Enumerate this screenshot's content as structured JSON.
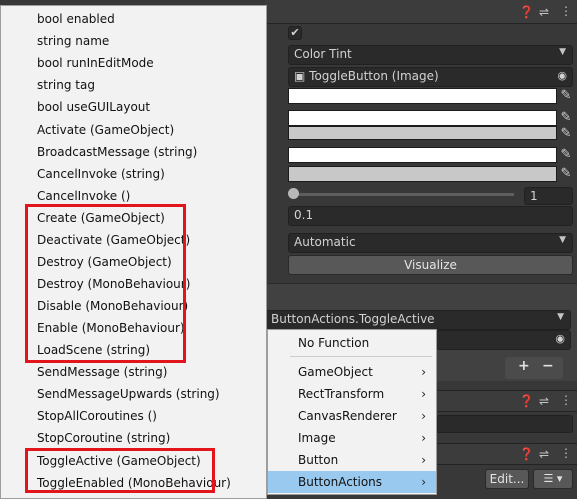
{
  "inspector": {
    "transition": "Color Tint",
    "target_graphic": "ToggleButton (Image)",
    "fade_duration": "1",
    "slider_value": "0.1",
    "navigation": "Automatic",
    "visualize_label": "Visualize",
    "onclick_function": "ButtonActions.ToggleActive",
    "add_label": "+",
    "remove_label": "−",
    "edit_label": "Edit...",
    "checkbox_glyph": "✔",
    "icons": [
      "help-icon",
      "presets-icon",
      "more-icon",
      "eyedropper-icon",
      "target-icon",
      "list-icon"
    ]
  },
  "method_menu": {
    "items": [
      "bool enabled",
      "string name",
      "bool runInEditMode",
      "string tag",
      "bool useGUILayout",
      "Activate (GameObject)",
      "BroadcastMessage (string)",
      "CancelInvoke (string)",
      "CancelInvoke ()",
      "Create (GameObject)",
      "Deactivate (GameObject)",
      "Destroy (GameObject)",
      "Destroy (MonoBehaviour)",
      "Disable (MonoBehaviour)",
      "Enable (MonoBehaviour)",
      "LoadScene (string)",
      "SendMessage (string)",
      "SendMessageUpwards (string)",
      "StopAllCoroutines ()",
      "StopCoroutine (string)",
      "ToggleActive (GameObject)",
      "ToggleEnabled (MonoBehaviour)"
    ]
  },
  "component_menu": {
    "items": [
      "No Function",
      "GameObject",
      "RectTransform",
      "CanvasRenderer",
      "Image",
      "Button",
      "ButtonActions"
    ],
    "chevron": "›"
  },
  "colors": {
    "highlight_box": "#e1151b",
    "selected_item": "#99c9ef"
  }
}
